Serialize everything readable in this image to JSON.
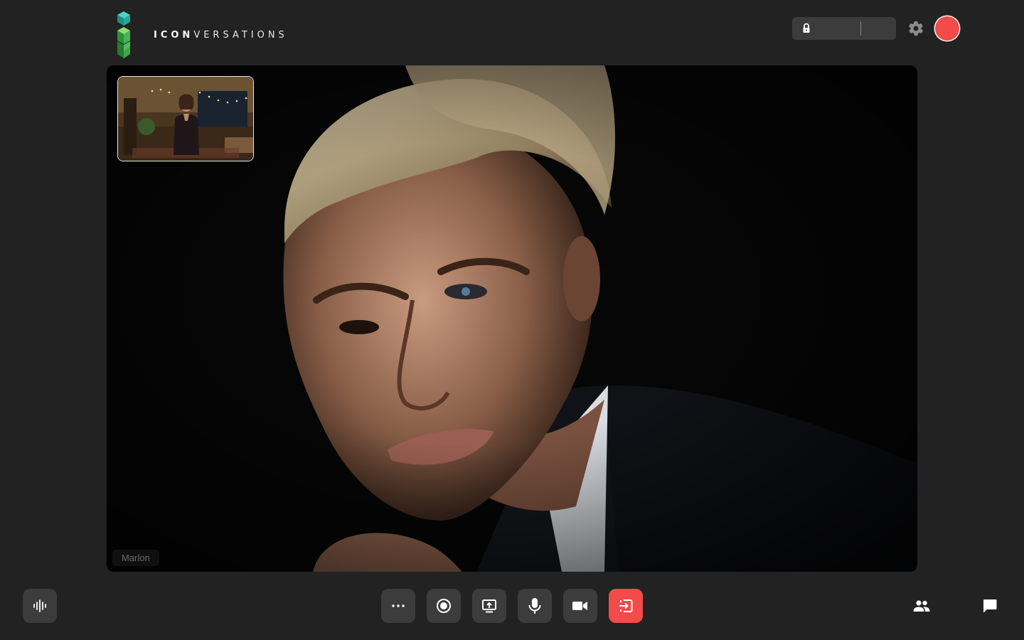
{
  "app": {
    "brand_bold": "ICON",
    "brand_light": "VERSATIONS"
  },
  "header": {
    "room_value": "",
    "avatar_color": "#f34a4a"
  },
  "main_video": {
    "participant_name": "Marlon"
  },
  "controls": {
    "left": [
      {
        "name": "audio-visualizer-button",
        "icon": "waveform-icon"
      }
    ],
    "center": [
      {
        "name": "more-options-button",
        "icon": "more-dots-icon"
      },
      {
        "name": "record-button",
        "icon": "record-icon"
      },
      {
        "name": "share-screen-button",
        "icon": "share-screen-icon"
      },
      {
        "name": "microphone-button",
        "icon": "microphone-icon"
      },
      {
        "name": "camera-button",
        "icon": "video-camera-icon"
      },
      {
        "name": "leave-call-button",
        "icon": "exit-icon"
      }
    ],
    "right": [
      {
        "name": "participants-button",
        "icon": "people-icon"
      },
      {
        "name": "chat-button",
        "icon": "chat-bubble-icon"
      }
    ]
  },
  "colors": {
    "background": "#222222",
    "control": "#3c3c3c",
    "danger": "#f34a4a",
    "brand_green": "#3fbf5a",
    "brand_teal": "#2aa7a0"
  }
}
